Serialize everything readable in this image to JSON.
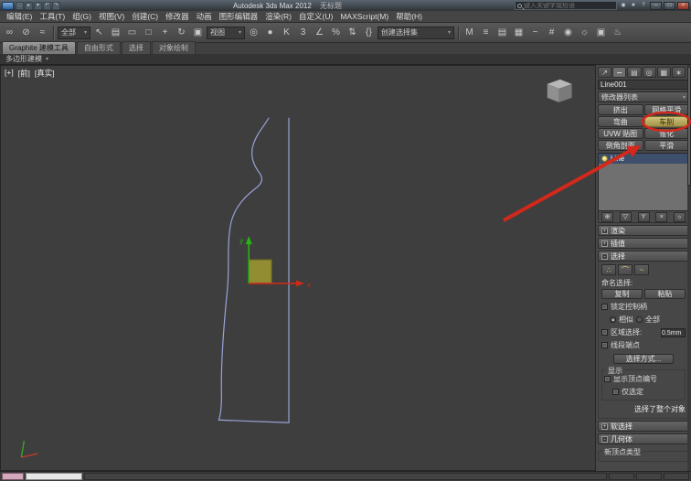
{
  "icons": {
    "chevron_down": "▾"
  },
  "window": {
    "title": "Autodesk 3ds Max 2012",
    "document": "无标题",
    "search_placeholder": "键入关键字或短语",
    "minimize": "–",
    "maximize": "□",
    "close": "×"
  },
  "quick_access": [
    {
      "name": "new-scene-icon",
      "glyph": "□"
    },
    {
      "name": "open-file-icon",
      "glyph": "▸"
    },
    {
      "name": "save-file-icon",
      "glyph": "▾"
    },
    {
      "name": "undo-icon",
      "glyph": "↶"
    },
    {
      "name": "redo-icon",
      "glyph": "↷"
    }
  ],
  "infocenter": [
    {
      "name": "communication-center-icon",
      "glyph": "◉"
    },
    {
      "name": "favorites-star-icon",
      "glyph": "★"
    },
    {
      "name": "help-icon",
      "glyph": "?"
    }
  ],
  "menubar": [
    "编辑(E)",
    "工具(T)",
    "组(G)",
    "视图(V)",
    "创建(C)",
    "修改器",
    "动画",
    "图形编辑器",
    "渲染(R)",
    "自定义(U)",
    "MAXScript(M)",
    "帮助(H)"
  ],
  "toolbar": {
    "link_group": [
      {
        "name": "select-and-link-icon",
        "glyph": "∞"
      },
      {
        "name": "unlink-selection-icon",
        "glyph": "⊘"
      },
      {
        "name": "bind-to-space-warp-icon",
        "glyph": "≈"
      }
    ],
    "filter_value": "全部",
    "select_group": [
      {
        "name": "select-object-icon",
        "glyph": "↖"
      },
      {
        "name": "select-by-name-icon",
        "glyph": "▤"
      },
      {
        "name": "rectangular-selection-region-icon",
        "glyph": "▭"
      },
      {
        "name": "window-crossing-icon",
        "glyph": "□"
      },
      {
        "name": "select-and-move-icon",
        "glyph": "+"
      },
      {
        "name": "select-and-rotate-icon",
        "glyph": "↻"
      },
      {
        "name": "select-and-scale-icon",
        "glyph": "▣"
      }
    ],
    "coord_value": "视图",
    "snap_group": [
      {
        "name": "use-pivot-point-center-icon",
        "glyph": "◎"
      },
      {
        "name": "select-and-manipulate-icon",
        "glyph": "●"
      },
      {
        "name": "keyboard-shortcut-override-icon",
        "glyph": "K"
      },
      {
        "name": "snaps-toggle-3d-icon",
        "glyph": "3"
      },
      {
        "name": "angle-snap-icon",
        "glyph": "∠"
      },
      {
        "name": "percent-snap-icon",
        "glyph": "%"
      },
      {
        "name": "spinner-snap-icon",
        "glyph": "⇅"
      },
      {
        "name": "edit-named-selection-sets-icon",
        "glyph": "{}"
      }
    ],
    "named_sets_value": "创建选择集",
    "render_group": [
      {
        "name": "mirror-icon",
        "glyph": "M"
      },
      {
        "name": "align-icon",
        "glyph": "≡"
      },
      {
        "name": "layer-manager-icon",
        "glyph": "▤"
      },
      {
        "name": "graphite-ribbon-toggle-icon",
        "glyph": "▦"
      },
      {
        "name": "curve-editor-icon",
        "glyph": "~"
      },
      {
        "name": "schematic-view-icon",
        "glyph": "#"
      },
      {
        "name": "material-editor-icon",
        "glyph": "◉"
      },
      {
        "name": "render-setup-icon",
        "glyph": "☼"
      },
      {
        "name": "rendered-frame-window-icon",
        "glyph": "▣"
      },
      {
        "name": "render-production-icon",
        "glyph": "♨"
      }
    ]
  },
  "ribbon": {
    "tabs": [
      {
        "label": "Graphite 建模工具",
        "active": true
      },
      {
        "label": "自由形式"
      },
      {
        "label": "选择"
      },
      {
        "label": "对象绘制"
      }
    ],
    "subtab": "多边形建模"
  },
  "viewport": {
    "nav": {
      "general": "[+]",
      "view": "[前]",
      "shading": "[真实]"
    },
    "gizmo": {
      "x_label": "x",
      "y_label": "y"
    }
  },
  "panel": {
    "tabs": [
      {
        "name": "create-tab-icon",
        "glyph": "↗"
      },
      {
        "name": "modify-tab-icon",
        "glyph": "∽",
        "active": true
      },
      {
        "name": "hierarchy-tab-icon",
        "glyph": "▤"
      },
      {
        "name": "motion-tab-icon",
        "glyph": "◎"
      },
      {
        "name": "display-tab-icon",
        "glyph": "▦"
      },
      {
        "name": "utilities-tab-icon",
        "glyph": "∗"
      }
    ],
    "object_name": "Line001",
    "modifier_list_label": "修改器列表",
    "modifier_buttons": [
      {
        "label": "挤出"
      },
      {
        "label": "网格平滑"
      },
      {
        "label": "弯曲"
      },
      {
        "label": "车削",
        "highlight": true
      },
      {
        "label": "UVW 贴图"
      },
      {
        "label": "锥化"
      },
      {
        "label": "倒角剖面"
      },
      {
        "label": "平滑"
      }
    ],
    "stack_items": [
      {
        "label": "Line",
        "selected": true
      }
    ],
    "stack_tools": [
      {
        "name": "pin-stack-icon",
        "glyph": "⊕"
      },
      {
        "name": "show-end-result-icon",
        "glyph": "▽"
      },
      {
        "name": "make-unique-icon",
        "glyph": "Y"
      },
      {
        "name": "remove-modifier-icon",
        "glyph": "×"
      },
      {
        "name": "configure-modifier-sets-icon",
        "glyph": "☼"
      }
    ],
    "rollouts": {
      "render": {
        "state": "+",
        "label": "渲染"
      },
      "interpolation": {
        "state": "+",
        "label": "插值"
      },
      "selection": {
        "state": "-",
        "label": "选择"
      },
      "soft_selection": {
        "state": "+",
        "label": "软选择"
      },
      "geometry": {
        "state": "-",
        "label": "几何体"
      }
    },
    "subobject_icons": [
      {
        "name": "vertex-subobject-icon",
        "glyph": "∴"
      },
      {
        "name": "segment-subobject-icon",
        "glyph": "⌒"
      },
      {
        "name": "spline-subobject-icon",
        "glyph": "~"
      }
    ],
    "selection": {
      "named_label": "命名选择:",
      "copy": "复制",
      "paste": "粘贴",
      "lock_handles": "锁定控制柄",
      "radio_similar": "相似",
      "radio_all": "全部",
      "area_selection": "区域选择:",
      "area_value": "0.5mm",
      "segment_end": "线段端点",
      "select_by": "选择方式...",
      "display_group": "显示",
      "show_vertex_numbers": "显示顶点编号",
      "selected_only": "仅选定",
      "status": "选择了整个对象"
    },
    "geometry_group_label": "新顶点类型"
  }
}
